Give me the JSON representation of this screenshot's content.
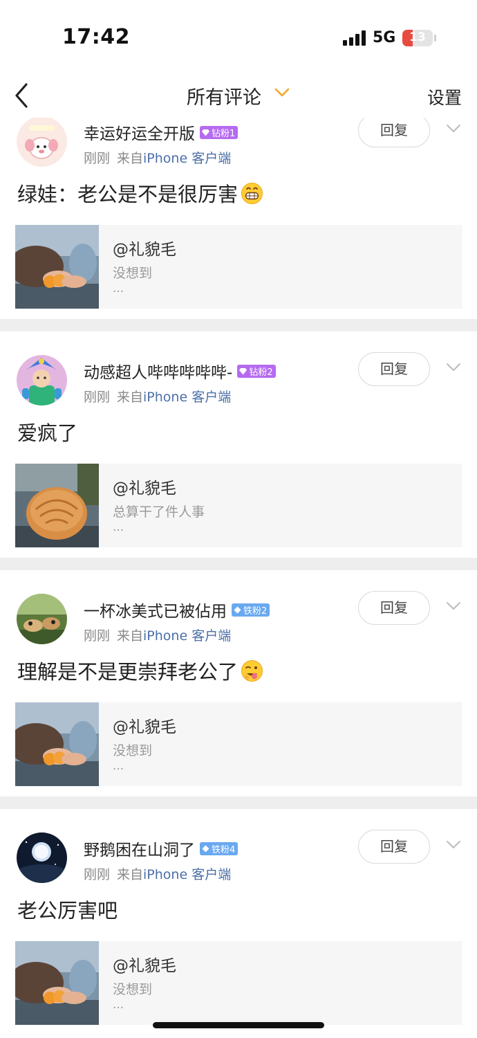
{
  "status_bar": {
    "time": "17:42",
    "network": "5G",
    "battery": "13",
    "battery_color": "#e84a3f"
  },
  "nav": {
    "title": "所有评论",
    "settings": "设置",
    "accent_color": "#f5a623"
  },
  "comments": [
    {
      "username": "幸运好运全开版",
      "badge": "钻粉1",
      "badge_kind": "purple",
      "time": "刚刚",
      "source_prefix": "来自",
      "device": "iPhone 客户端",
      "reply_label": "回复",
      "content": "绿娃：老公是不是很厉害",
      "emoji": "grin-emoji",
      "quote": {
        "user": "@礼貌毛",
        "text": "没想到",
        "ellipsis": "..."
      }
    },
    {
      "username": "动感超人哔哔哔哔哔-",
      "badge": "钻粉2",
      "badge_kind": "purple",
      "time": "刚刚",
      "source_prefix": "来自",
      "device": "iPhone 客户端",
      "reply_label": "回复",
      "content": "爱疯了",
      "emoji": "",
      "quote": {
        "user": "@礼貌毛",
        "text": "总算干了件人事",
        "ellipsis": "..."
      }
    },
    {
      "username": "一杯冰美式已被佔用",
      "badge": "铁粉2",
      "badge_kind": "blue",
      "time": "刚刚",
      "source_prefix": "来自",
      "device": "iPhone 客户端",
      "reply_label": "回复",
      "content": "理解是不是更崇拜老公了",
      "emoji": "wink-tongue-emoji",
      "quote": {
        "user": "@礼貌毛",
        "text": "没想到",
        "ellipsis": "..."
      }
    },
    {
      "username": "野鹅困在山洞了",
      "badge": "铁粉4",
      "badge_kind": "blue",
      "time": "刚刚",
      "source_prefix": "来自",
      "device": "iPhone 客户端",
      "reply_label": "回复",
      "content": "老公厉害吧",
      "emoji": "",
      "quote": {
        "user": "@礼貌毛",
        "text": "没想到",
        "ellipsis": "..."
      }
    }
  ]
}
